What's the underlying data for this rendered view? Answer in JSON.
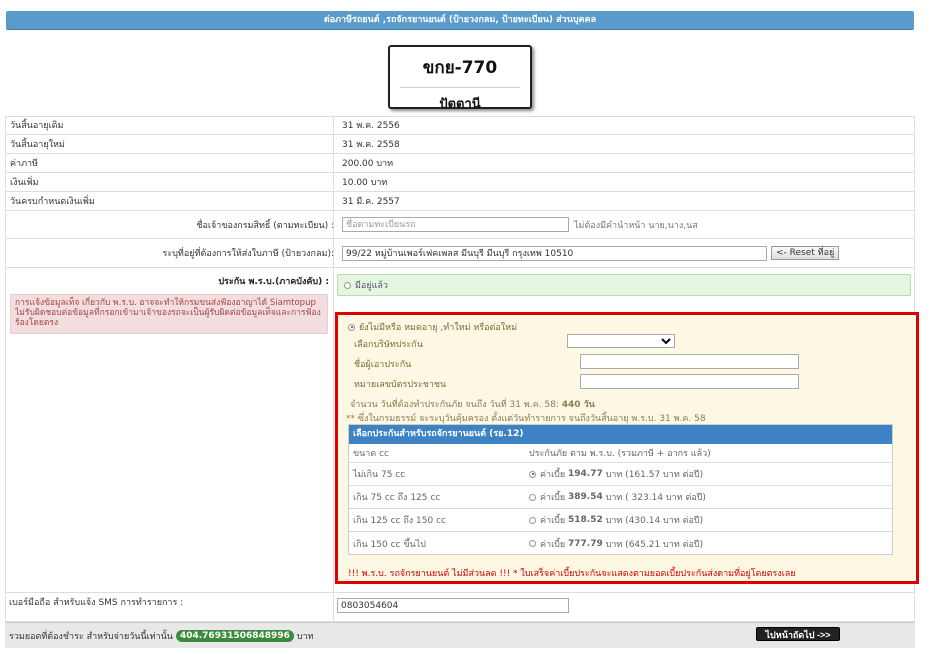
{
  "header": {
    "title": "ต่อภาษีรถยนต์ ,รถจักรยานยนต์ (ป้ายวงกลม, ป้ายทะเบียน) ส่วนบุคคล"
  },
  "plate": {
    "number": "ขกย-770",
    "province": "ปัตตานี"
  },
  "info_rows": [
    {
      "label": "วันสิ้นอายุเดิม",
      "value": "31 พ.ค. 2556"
    },
    {
      "label": "วันสิ้นอายุใหม่",
      "value": "31 พ.ค. 2558"
    },
    {
      "label": "ค่าภาษี",
      "value": "200.00 บาท"
    },
    {
      "label": "เงินเพิ่ม",
      "value": "10.00 บาท"
    },
    {
      "label": "วันครบกำหนดเงินเพิ่ม",
      "value": "31 มี.ค. 2557"
    }
  ],
  "owner": {
    "label": "ชื่อเจ้าของกรมสิทธิ์ (ตามทะเบียน) :",
    "placeholder": "ชื่อตามทะเบียนรถ",
    "hint": "ไม่ต้องมีคำนำหน้า นาย,นาง,นส"
  },
  "address": {
    "label": "ระบุที่อยู่ที่ต้องการให้ส่งใบภาษี (ป้ายวงกลม):",
    "value": "99/22 หมู่บ้านเพอร์เฟคเพลส มีนบุรี มีนบุรี กรุงเทพ 10510",
    "reset_label": "<- Reset ที่อยู่"
  },
  "insurance": {
    "label": "ประกัน พ.ร.บ.(ภาคบังคับ) :",
    "option_have": "มีอยู่แล้ว",
    "warning": "การแจ้งข้อมูลเท็จ เกี่ยวกับ พ.ร.บ. อาจจะทำให้กรมขนส่งฟ้องอาญาได้ Siamtopup ไม่รับผิดชอบต่อข้อมูลที่กรอกเข้ามาเจ้าของรถจะเป็นผู้รับผิดต่อข้อมูลเท็จและการฟ้องร้องโดยตรง",
    "option_new": "ยังไม่มีหรือ หมดอายุ ,ทำใหม่ หรือต่อใหม่",
    "company_label": "เลือกบริษัทประกัน",
    "insured_name_label": "ชื่อผู้เอาประกัน",
    "id_card_label": "หมายเลขบัตรประชาชน",
    "days_text": "จำนวน วันที่ต้องทำประกันภัย จนถึง วันที่ 31 พ.ค. 58:",
    "days_value": "440 วัน",
    "note": "** ซึ่งในกรมธรรม์ จะระบุวันคุ้มครอง ตั้งแต่วันทำรายการ จนถึงวันสิ้นอายุ พ.ร.บ. 31 พ.ค. 58",
    "table_title": "เลือกประกันสำหรับรถจักรยานยนต์ (รย.12)",
    "col_size": "ขนาด cc",
    "col_premium": "ประกันภัย ตาม พ.ร.บ. (รวมภาษี + อากร แล้ว)",
    "rows": [
      {
        "size": "ไม่เกิน 75 cc",
        "prefix": "ค่าเบี้ย",
        "amount": "194.77",
        "suffix": "บาท (161.57 บาท ต่อปี)",
        "selected": true
      },
      {
        "size": "เกิน 75 cc ถึง 125 cc",
        "prefix": "ค่าเบี้ย",
        "amount": "389.54",
        "suffix": "บาท ( 323.14 บาท ต่อปี)",
        "selected": false
      },
      {
        "size": "เกิน 125 cc ถึง 150 cc",
        "prefix": "ค่าเบี้ย",
        "amount": "518.52",
        "suffix": "บาท (430.14 บาท ต่อปี)",
        "selected": false
      },
      {
        "size": "เกิน 150 cc ขึ้นไป",
        "prefix": "ค่าเบี้ย",
        "amount": "777.79",
        "suffix": "บาท (645.21 บาท ต่อปี)",
        "selected": false
      }
    ],
    "footer_note": "!!! พ.ร.บ. รถจักรยานยนต์ ไม่มีส่วนลด !!! * ใบเสร็จค่าเบี้ยประกันจะแสดงตามยอดเบี้ยประกันส่งตามที่อยู่โดยตรงเลย"
  },
  "sms": {
    "label": "เบอร์มือถือ สำหรับแจ้ง SMS การทำรายการ :",
    "value": "0803054604"
  },
  "total": {
    "prefix": "รวมยอดที่ต้องชำระ สำหรับจ่ายวันนี้เท่านั้น",
    "amount": "404.76931506848996",
    "suffix": "บาท",
    "next_label": "ไปหน้าถัดไป ->>"
  }
}
